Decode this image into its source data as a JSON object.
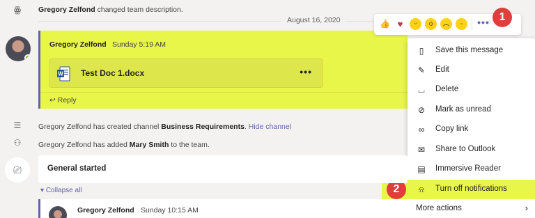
{
  "system_messages": {
    "team_desc": {
      "name": "Gregory Zelfond",
      "text": " changed team description."
    },
    "channel_created": {
      "name": "Gregory Zelfond",
      "text1": " has created channel ",
      "channel": "Business Requirements",
      "text2": ". ",
      "link": "Hide channel"
    },
    "member_added": {
      "name": "Gregory Zelfond",
      "text1": " has added ",
      "member": "Mary Smith",
      "text2": " to the team."
    }
  },
  "date_separator": "August 16, 2020",
  "message": {
    "sender": "Gregory Zelfond",
    "time": "Sunday 5:19 AM",
    "file_name": "Test Doc 1.docx",
    "file_more": "•••",
    "reply_label": "Reply"
  },
  "reactions": {
    "items": [
      "like-icon",
      "heart-icon",
      "laugh-icon",
      "surprised-icon",
      "sad-icon",
      "angry-icon"
    ],
    "more": "•••"
  },
  "badges": {
    "first": "1",
    "second": "2"
  },
  "context_menu": {
    "items": [
      {
        "icon": "bookmark-icon",
        "glyph": "⌑",
        "label": "Save this message"
      },
      {
        "icon": "pencil-icon",
        "glyph": "✎",
        "label": "Edit"
      },
      {
        "icon": "trash-icon",
        "glyph": "🗑",
        "label": "Delete"
      },
      {
        "icon": "eye-off-icon",
        "glyph": "◌",
        "label": "Mark as unread"
      },
      {
        "icon": "link-icon",
        "glyph": "∞",
        "label": "Copy link"
      },
      {
        "icon": "mail-icon",
        "glyph": "✉",
        "label": "Share to Outlook"
      },
      {
        "icon": "reader-icon",
        "glyph": "▤",
        "label": "Immersive Reader"
      },
      {
        "icon": "bell-off-icon",
        "glyph": "🔕",
        "label": "Turn off notifications"
      }
    ],
    "more_actions": "More actions"
  },
  "meeting": {
    "title": "General started",
    "collapse_label": "Collapse all",
    "nested_sender": "Gregory Zelfond",
    "nested_time": "Sunday 10:15 AM"
  },
  "colors": {
    "accent": "#6264a7",
    "highlight": "#e8f549",
    "badge": "#e13d3d"
  }
}
